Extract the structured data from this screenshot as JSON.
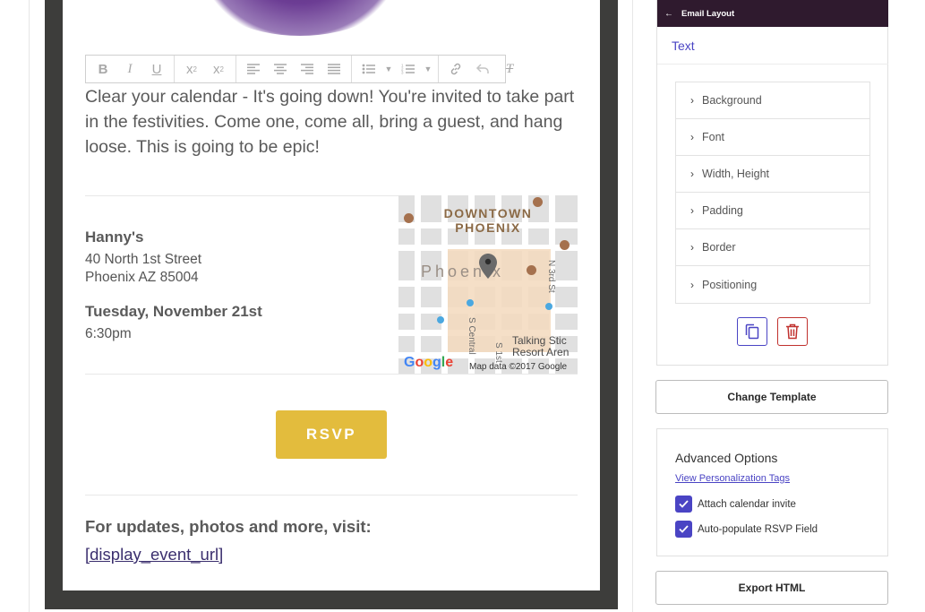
{
  "editor": {
    "toolbar": {
      "buttons": [
        "bold",
        "italic",
        "underline",
        "subscript",
        "superscript",
        "align-left",
        "align-center",
        "align-right",
        "justify",
        "bullet-list",
        "numbered-list",
        "link",
        "undo",
        "clear-format"
      ]
    },
    "intro_text": "Clear your calendar - It's going down! You're invited to take part in the festivities. Come one, come all, bring a guest, and hang loose. This is going to be epic!",
    "venue": {
      "name": "Hanny's",
      "address_line1": "40 North 1st Street",
      "address_line2": "Phoenix AZ 85004"
    },
    "event": {
      "date": "Tuesday, November 21st",
      "time": "6:30pm"
    },
    "map": {
      "downtown_label_1": "DOWNTOWN",
      "downtown_label_2": "PHOENIX",
      "city_label": "Phoenix",
      "street_1": "N 3rd St",
      "street_2": "S Central",
      "street_3": "S 1st",
      "poi_line1": "Talking Stic",
      "poi_line2": "Resort Aren",
      "logo": "Google",
      "attribution": "Map data ©2017 Google"
    },
    "rsvp_label": "RSVP",
    "updates_text": "For updates, photos and more, visit:",
    "event_url": "[display_event_url]"
  },
  "panel": {
    "header": "Email Layout",
    "active_tab": "Text",
    "sections": [
      "Background",
      "Font",
      "Width, Height",
      "Padding",
      "Border",
      "Positioning"
    ]
  },
  "actions": {
    "change_template": "Change Template",
    "export_html": "Export HTML"
  },
  "advanced": {
    "title": "Advanced Options",
    "link": "View Personalization Tags",
    "option_1": "Attach calendar invite",
    "option_2": "Auto-populate RSVP Field"
  },
  "colors": {
    "accent": "#4a44c4",
    "rsvp": "#e3bc3d",
    "header_bg": "#2f1a2e",
    "danger": "#c0312e"
  }
}
